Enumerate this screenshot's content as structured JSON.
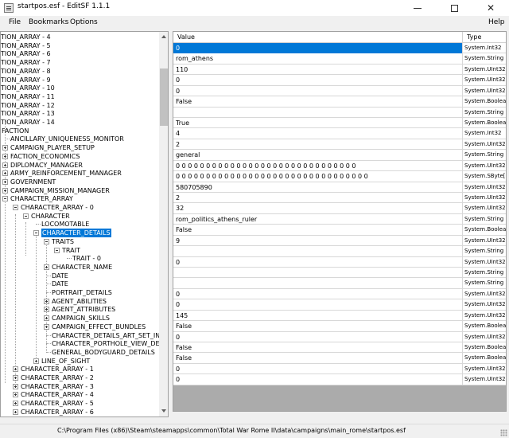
{
  "window": {
    "title": "startpos.esf - EditSF 1.1.1",
    "icons": {
      "app": "document-icon",
      "minimize": "minimize-icon",
      "maximize": "maximize-icon",
      "close": "close-icon"
    }
  },
  "menu": {
    "file": "File",
    "bookmarks": "Bookmarks",
    "options": "Options",
    "help": "Help"
  },
  "tree": {
    "nodes": [
      {
        "label": "TION_ARRAY - 4"
      },
      {
        "label": "TION_ARRAY - 5"
      },
      {
        "label": "TION_ARRAY - 6"
      },
      {
        "label": "TION_ARRAY - 7"
      },
      {
        "label": "TION_ARRAY - 8"
      },
      {
        "label": "TION_ARRAY - 9"
      },
      {
        "label": "TION_ARRAY - 10"
      },
      {
        "label": "TION_ARRAY - 11"
      },
      {
        "label": "TION_ARRAY - 12"
      },
      {
        "label": "TION_ARRAY - 13"
      },
      {
        "label": "TION_ARRAY - 14"
      },
      {
        "label": "FACTION"
      },
      {
        "label": "ANCILLARY_UNIQUENESS_MONITOR"
      },
      {
        "label": "CAMPAIGN_PLAYER_SETUP"
      },
      {
        "label": "FACTION_ECONOMICS"
      },
      {
        "label": "DIPLOMACY_MANAGER"
      },
      {
        "label": "ARMY_REINFORCEMENT_MANAGER"
      },
      {
        "label": "GOVERNMENT"
      },
      {
        "label": "CAMPAIGN_MISSION_MANAGER"
      },
      {
        "label": "CHARACTER_ARRAY"
      },
      {
        "label": "CHARACTER_ARRAY - 0"
      },
      {
        "label": "CHARACTER"
      },
      {
        "label": "LOCOMOTABLE"
      },
      {
        "label": "CHARACTER_DETAILS"
      },
      {
        "label": "TRAITS"
      },
      {
        "label": "TRAIT"
      },
      {
        "label": "TRAIT - 0"
      },
      {
        "label": "CHARACTER_NAME"
      },
      {
        "label": "DATE"
      },
      {
        "label": "DATE"
      },
      {
        "label": "PORTRAIT_DETAILS"
      },
      {
        "label": "AGENT_ABILITIES"
      },
      {
        "label": "AGENT_ATTRIBUTES"
      },
      {
        "label": "CAMPAIGN_SKILLS"
      },
      {
        "label": "CAMPAIGN_EFFECT_BUNDLES"
      },
      {
        "label": "CHARACTER_DETAILS_ART_SET_INFO"
      },
      {
        "label": "CHARACTER_PORTHOLE_VIEW_DETAI"
      },
      {
        "label": "GENERAL_BODYGUARD_DETAILS"
      },
      {
        "label": "LINE_OF_SIGHT"
      },
      {
        "label": "CHARACTER_ARRAY - 1"
      },
      {
        "label": "CHARACTER_ARRAY - 2"
      },
      {
        "label": "CHARACTER_ARRAY - 3"
      },
      {
        "label": "CHARACTER_ARRAY - 4"
      },
      {
        "label": "CHARACTER_ARRAY - 5"
      },
      {
        "label": "CHARACTER_ARRAY - 6"
      }
    ]
  },
  "grid": {
    "headers": {
      "value": "Value",
      "type": "Type"
    },
    "rows": [
      {
        "value": "0",
        "type": "System.Int32"
      },
      {
        "value": "rom_athens",
        "type": "System.String"
      },
      {
        "value": "110",
        "type": "System.UInt32"
      },
      {
        "value": "0",
        "type": "System.UInt32"
      },
      {
        "value": "0",
        "type": "System.UInt32"
      },
      {
        "value": "False",
        "type": "System.Boolean"
      },
      {
        "value": "",
        "type": "System.String"
      },
      {
        "value": "True",
        "type": "System.Boolean"
      },
      {
        "value": "4",
        "type": "System.Int32"
      },
      {
        "value": "2",
        "type": "System.UInt32"
      },
      {
        "value": "general",
        "type": "System.String"
      },
      {
        "value": "0 0 0 0 0 0 0 0 0 0 0 0 0 0 0 0 0 0 0 0 0 0 0 0 0 0 0 0 0 0",
        "type": "System.UInt32[]"
      },
      {
        "value": "0 0 0 0 0 0 0 0 0 0 0 0 0 0 0 0 0 0 0 0 0 0 0 0 0 0 0 0 0 0 0 0",
        "type": "System.SByte[]"
      },
      {
        "value": "580705890",
        "type": "System.UInt32"
      },
      {
        "value": "2",
        "type": "System.UInt32"
      },
      {
        "value": "32",
        "type": "System.UInt32"
      },
      {
        "value": "rom_politics_athens_ruler",
        "type": "System.String"
      },
      {
        "value": "False",
        "type": "System.Boolean"
      },
      {
        "value": "9",
        "type": "System.UInt32"
      },
      {
        "value": "",
        "type": "System.String"
      },
      {
        "value": "0",
        "type": "System.UInt32"
      },
      {
        "value": "",
        "type": "System.String"
      },
      {
        "value": "",
        "type": "System.String"
      },
      {
        "value": "0",
        "type": "System.UInt32"
      },
      {
        "value": "0",
        "type": "System.UInt32"
      },
      {
        "value": "145",
        "type": "System.UInt32"
      },
      {
        "value": "False",
        "type": "System.Boolean"
      },
      {
        "value": "0",
        "type": "System.UInt32"
      },
      {
        "value": "False",
        "type": "System.Boolean"
      },
      {
        "value": "False",
        "type": "System.Boolean"
      },
      {
        "value": "0",
        "type": "System.UInt32"
      },
      {
        "value": "0",
        "type": "System.UInt32"
      }
    ]
  },
  "status": {
    "path": "C:\\Program Files (x86)\\Steam\\steamapps\\common\\Total War Rome II\\data\\campaigns\\main_rome\\startpos.esf"
  }
}
